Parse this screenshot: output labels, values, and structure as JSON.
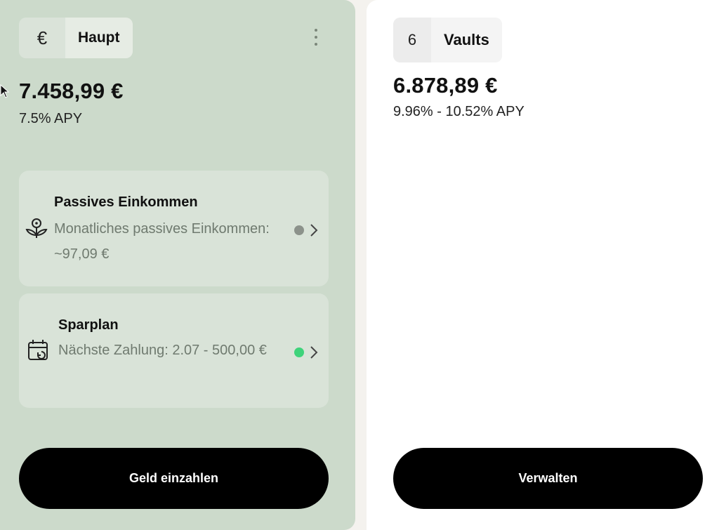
{
  "main_account": {
    "currency_symbol": "€",
    "name": "Haupt",
    "balance": "7.458,99 €",
    "apy": "7.5% APY",
    "cards": [
      {
        "icon": "flower-coin-icon",
        "title": "Passives Einkommen",
        "subtitle": "Monatliches passives Einkommen: ~97,09 €",
        "status_color": "#8c928b"
      },
      {
        "icon": "calendar-repeat-icon",
        "title": "Sparplan",
        "subtitle": "Nächste Zahlung: 2.07 - 500,00 €",
        "status_color": "#3ed37a"
      }
    ],
    "deposit_button": "Geld einzahlen"
  },
  "vaults": {
    "count": "6",
    "label": "Vaults",
    "balance": "6.878,89 €",
    "apy_range": "9.96% - 10.52% APY",
    "manage_button": "Verwalten"
  }
}
